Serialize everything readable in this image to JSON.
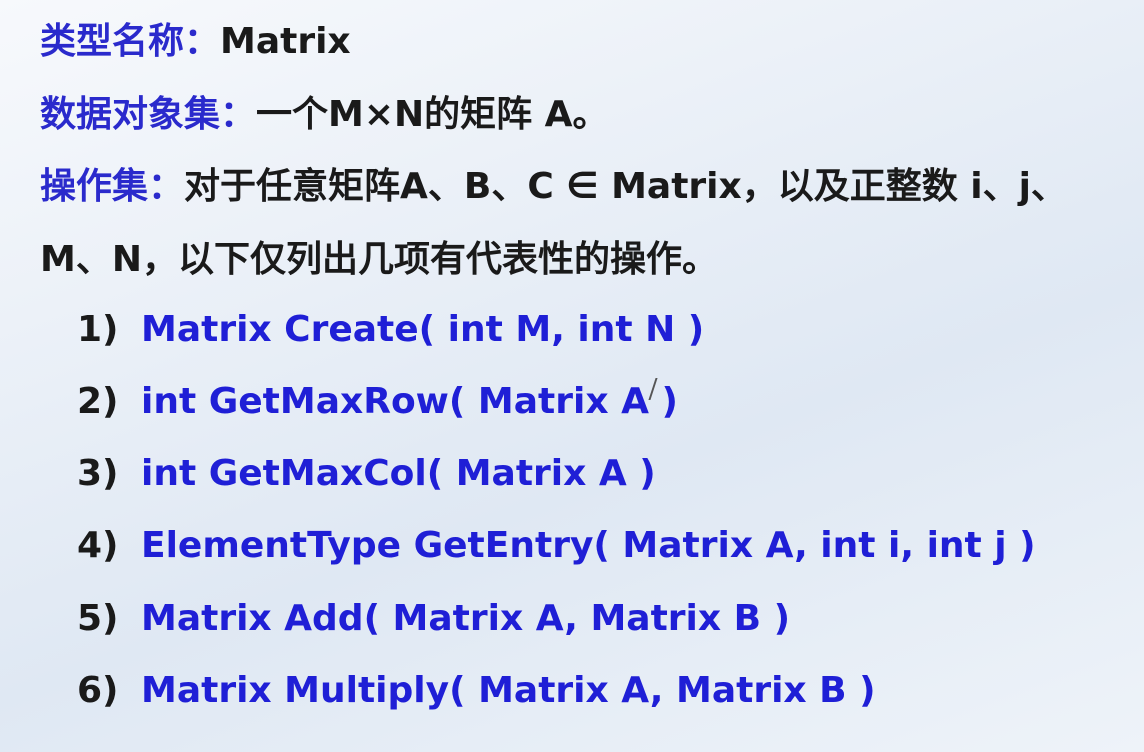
{
  "type_name": {
    "label": "类型名称：",
    "value": "Matrix"
  },
  "data_object_set": {
    "label": "数据对象集：",
    "value": "一个M×N的矩阵 A。"
  },
  "operation_set": {
    "label": "操作集：",
    "line1": "对于任意矩阵A、B、C ∈ Matrix，以及正整数 i、j、",
    "line2": "M、N，以下仅列出几项有代表性的操作。"
  },
  "operations": [
    {
      "num": "1)",
      "signature": "Matrix Create( int M, int N )"
    },
    {
      "num": "2)",
      "signature": "int GetMaxRow( Matrix A )"
    },
    {
      "num": "3)",
      "signature": "int GetMaxCol( Matrix A )"
    },
    {
      "num": "4)",
      "signature": "ElementType GetEntry( Matrix A, int i, int j )"
    },
    {
      "num": "5)",
      "signature": "Matrix Add( Matrix A, Matrix B )"
    },
    {
      "num": "6)",
      "signature": "Matrix Multiply( Matrix A, Matrix B )"
    }
  ],
  "colors": {
    "label": "#2a2acc",
    "signature": "#1f1fd6",
    "text": "#1a1a1a"
  }
}
